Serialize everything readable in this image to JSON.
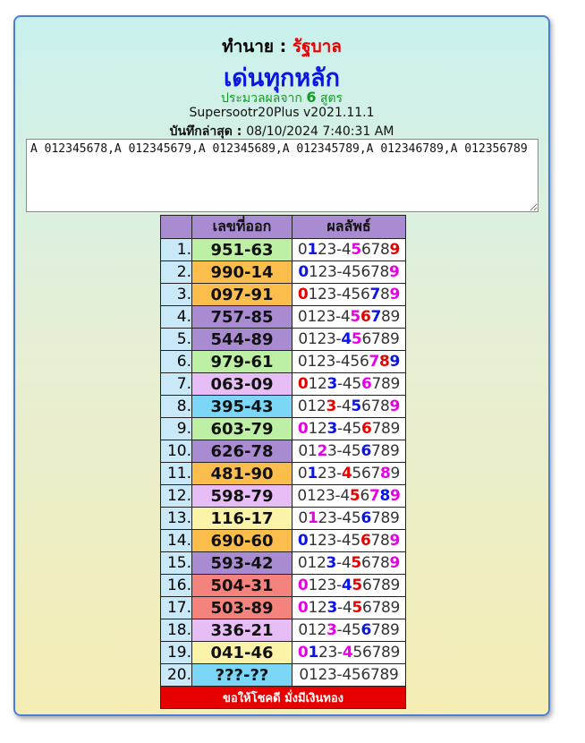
{
  "header": {
    "predict_label": "ทำนาย : ",
    "lottery_name": "รัฐบาล",
    "subtitle": "เด่นทุกหลัก",
    "summary_prefix": "ประมวลผลจาก ",
    "summary_count": "6",
    "summary_suffix": " สูตร",
    "software": "Supersootr20Plus v2021.11.1",
    "saved_label": "บันทึกล่าสุด : ",
    "saved_time": "08/10/2024 7:40:31 AM"
  },
  "formula_text": "A 012345678,A 012345679,A 012345689,A 012345789,A 012346789,A 012356789",
  "table": {
    "col_number": "เลขที่ออก",
    "col_result": "ผลลัพธ์",
    "footer": "ขอให้โชคดี มั่งมีเงินทอง",
    "rows": [
      {
        "idx": "1.",
        "num": "951-63",
        "bg": "green",
        "digits": "0123-456789",
        "marks": {
          "1": "#0a14e6",
          "5": "#e600e6",
          "9": "#e60000"
        }
      },
      {
        "idx": "2.",
        "num": "990-14",
        "bg": "orange",
        "digits": "0123-456789",
        "marks": {
          "0": "#0a14e6",
          "9": "#e600e6"
        }
      },
      {
        "idx": "3.",
        "num": "097-91",
        "bg": "orange",
        "digits": "0123-456789",
        "marks": {
          "0": "#e60000",
          "7": "#0a14e6",
          "9": "#e600e6"
        }
      },
      {
        "idx": "4.",
        "num": "757-85",
        "bg": "purple",
        "digits": "0123-456789",
        "marks": {
          "5": "#e600e6",
          "6": "#e60000",
          "7": "#0a14e6"
        }
      },
      {
        "idx": "5.",
        "num": "544-89",
        "bg": "purple",
        "digits": "0123-456789",
        "marks": {
          "4": "#0a14e6",
          "5": "#e600e6"
        }
      },
      {
        "idx": "6.",
        "num": "979-61",
        "bg": "green",
        "digits": "0123-456789",
        "marks": {
          "7": "#e600e6",
          "8": "#e60000",
          "9": "#0a14e6"
        }
      },
      {
        "idx": "7.",
        "num": "063-09",
        "bg": "lav",
        "digits": "0123-456789",
        "marks": {
          "0": "#e60000",
          "3": "#0a14e6",
          "6": "#e600e6"
        }
      },
      {
        "idx": "8.",
        "num": "395-43",
        "bg": "blue",
        "digits": "0123-456789",
        "marks": {
          "3": "#e60000",
          "5": "#0a14e6",
          "9": "#e600e6"
        }
      },
      {
        "idx": "9.",
        "num": "603-79",
        "bg": "green",
        "digits": "0123-456789",
        "marks": {
          "0": "#e600e6",
          "3": "#0a14e6",
          "6": "#e60000"
        }
      },
      {
        "idx": "10.",
        "num": "626-78",
        "bg": "purple",
        "digits": "0123-456789",
        "marks": {
          "2": "#e600e6",
          "6": "#0a14e6"
        }
      },
      {
        "idx": "11.",
        "num": "481-90",
        "bg": "orange",
        "digits": "0123-456789",
        "marks": {
          "1": "#0a14e6",
          "4": "#e60000",
          "8": "#e600e6"
        }
      },
      {
        "idx": "12.",
        "num": "598-79",
        "bg": "lav",
        "digits": "0123-456789",
        "marks": {
          "5": "#e60000",
          "7": "#e600e6",
          "8": "#0a14e6",
          "9": "#e600e6"
        }
      },
      {
        "idx": "13.",
        "num": "116-17",
        "bg": "yellow",
        "digits": "0123-456789",
        "marks": {
          "1": "#e600e6",
          "6": "#0a14e6"
        }
      },
      {
        "idx": "14.",
        "num": "690-60",
        "bg": "orange",
        "digits": "0123-456789",
        "marks": {
          "0": "#0a14e6",
          "6": "#e60000",
          "9": "#e600e6"
        }
      },
      {
        "idx": "15.",
        "num": "593-42",
        "bg": "purple",
        "digits": "0123-456789",
        "marks": {
          "3": "#0a14e6",
          "5": "#e60000",
          "9": "#e600e6"
        }
      },
      {
        "idx": "16.",
        "num": "504-31",
        "bg": "salmon",
        "digits": "0123-456789",
        "marks": {
          "0": "#e600e6",
          "4": "#0a14e6",
          "5": "#e60000"
        }
      },
      {
        "idx": "17.",
        "num": "503-89",
        "bg": "salmon",
        "digits": "0123-456789",
        "marks": {
          "0": "#e600e6",
          "3": "#0a14e6",
          "5": "#e60000"
        }
      },
      {
        "idx": "18.",
        "num": "336-21",
        "bg": "lav",
        "digits": "0123-456789",
        "marks": {
          "3": "#e600e6",
          "6": "#0a14e6"
        }
      },
      {
        "idx": "19.",
        "num": "041-46",
        "bg": "yellow",
        "digits": "0123-456789",
        "marks": {
          "0": "#e600e6",
          "1": "#0a14e6",
          "4": "#e600e6"
        }
      },
      {
        "idx": "20.",
        "num": "???-??",
        "bg": "cyan",
        "digits": "0123-456789",
        "marks": {}
      }
    ]
  }
}
